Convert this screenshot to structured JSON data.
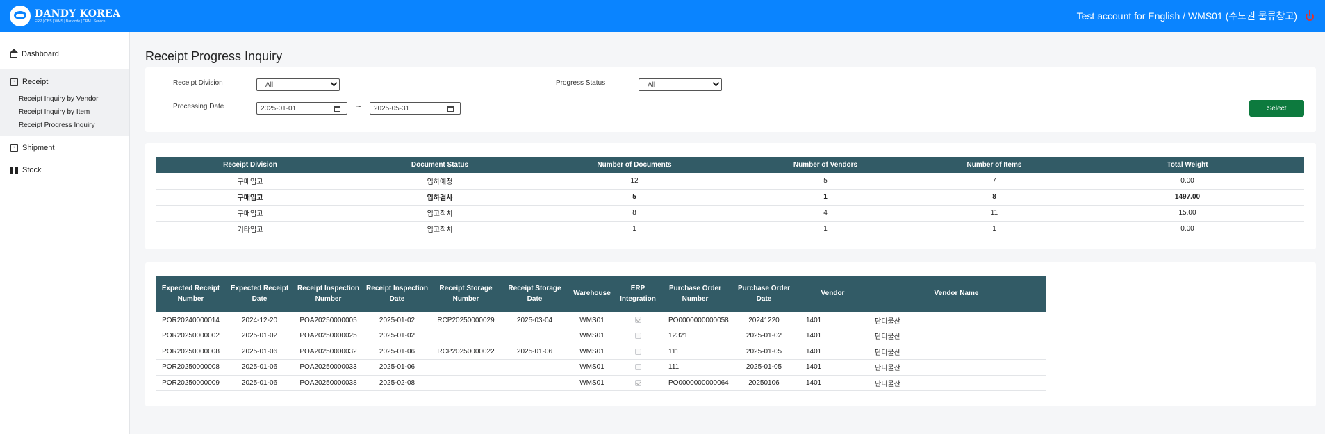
{
  "header": {
    "logo_name": "DANDY KOREA",
    "logo_tagline": "ERP | CBS | WMS | Bar-code | CRM | Service",
    "account_text": "Test account for English / WMS01 (수도권 물류창고)"
  },
  "sidebar": {
    "dashboard": "Dashboard",
    "receipt": "Receipt",
    "receipt_sub": [
      "Receipt Inquiry by Vendor",
      "Receipt Inquiry by Item",
      "Receipt Progress Inquiry"
    ],
    "shipment": "Shipment",
    "stock": "Stock"
  },
  "page_title": "Receipt Progress Inquiry",
  "filters": {
    "receipt_division_label": "Receipt Division",
    "receipt_division_value": "All",
    "progress_status_label": "Progress Status",
    "progress_status_value": "All",
    "processing_date_label": "Processing Date",
    "date_from": "2025-01-01",
    "date_separator": "~",
    "date_to": "2025-05-31",
    "select_button": "Select"
  },
  "summary": {
    "headers": [
      "Receipt Division",
      "Document Status",
      "Number of Documents",
      "Number of Vendors",
      "Number of Items",
      "Total Weight"
    ],
    "rows": [
      [
        "구매입고",
        "입하예정",
        "12",
        "5",
        "7",
        "0.00"
      ],
      [
        "구매입고",
        "입하검사",
        "5",
        "1",
        "8",
        "1497.00"
      ],
      [
        "구매입고",
        "입고적치",
        "8",
        "4",
        "11",
        "15.00"
      ],
      [
        "기타입고",
        "입고적치",
        "1",
        "1",
        "1",
        "0.00"
      ]
    ]
  },
  "detail": {
    "headers": [
      "Expected Receipt Number",
      "Expected Receipt Date",
      "Receipt Inspection Number",
      "Receipt Inspection Date",
      "Receipt Storage Number",
      "Receipt Storage Date",
      "Warehouse",
      "ERP Integration",
      "Purchase Order Number",
      "Purchase Order Date",
      "Vendor",
      "Vendor Name"
    ],
    "rows": [
      [
        "POR20240000014",
        "2024-12-20",
        "POA20250000005",
        "2025-01-02",
        "RCP20250000029",
        "2025-03-04",
        "WMS01",
        true,
        "PO0000000000058",
        "20241220",
        "1401",
        "단디물산"
      ],
      [
        "POR20250000002",
        "2025-01-02",
        "POA20250000025",
        "2025-01-02",
        "",
        "",
        "WMS01",
        false,
        "12321",
        "2025-01-02",
        "1401",
        "단디물산"
      ],
      [
        "POR20250000008",
        "2025-01-06",
        "POA20250000032",
        "2025-01-06",
        "RCP20250000022",
        "2025-01-06",
        "WMS01",
        false,
        "111",
        "2025-01-05",
        "1401",
        "단디물산"
      ],
      [
        "POR20250000008",
        "2025-01-06",
        "POA20250000033",
        "2025-01-06",
        "",
        "",
        "WMS01",
        false,
        "111",
        "2025-01-05",
        "1401",
        "단디물산"
      ],
      [
        "POR20250000009",
        "2025-01-06",
        "POA20250000038",
        "2025-02-08",
        "",
        "",
        "WMS01",
        true,
        "PO0000000000064",
        "20250106",
        "1401",
        "단디물산"
      ]
    ]
  },
  "colors": {
    "header_bg": "#0a84ff",
    "table_header_bg": "#325b66",
    "select_button_bg": "#0d7a3e",
    "power_icon": "#e0322b"
  }
}
